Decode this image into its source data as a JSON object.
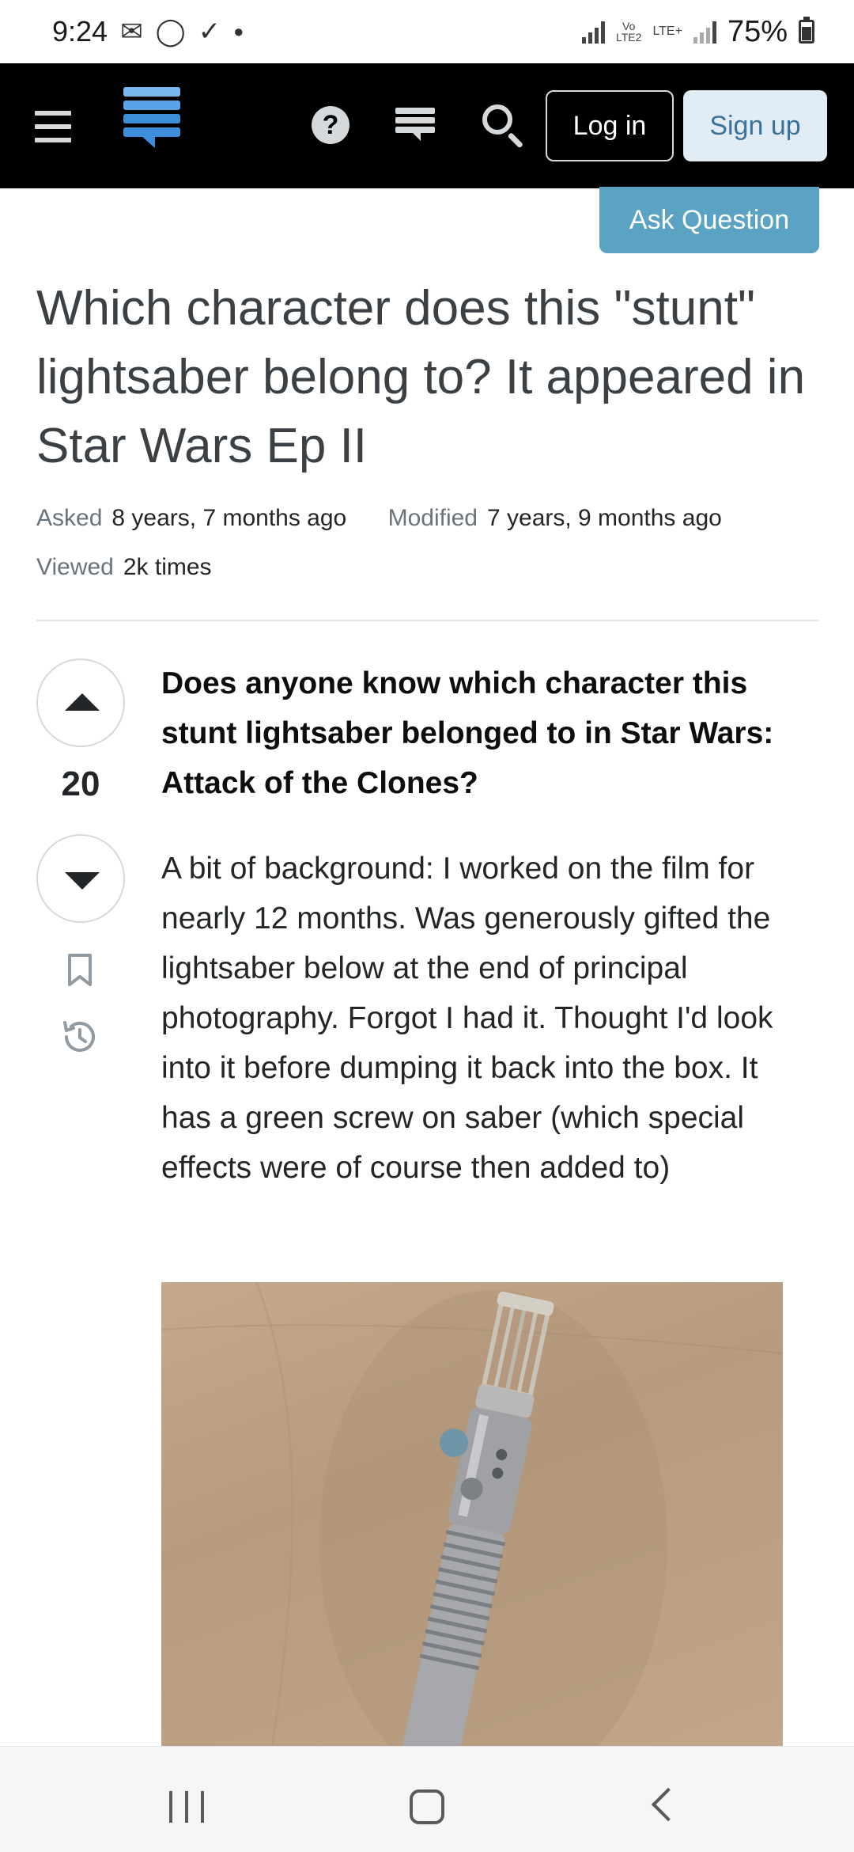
{
  "status_bar": {
    "time": "9:24",
    "icons": [
      "gmail-icon",
      "whatsapp-icon",
      "task-check-icon",
      "dot-icon"
    ],
    "network_label_top": "Vo",
    "network_label_bottom": "LTE2",
    "lte_label": "LTE+",
    "battery_percent": "75%"
  },
  "header": {
    "menu_icon": "hamburger-menu-icon",
    "logo_icon": "stack-exchange-logo-icon",
    "help_icon": "help-icon",
    "inbox_icon": "inbox-icon",
    "search_icon": "search-icon",
    "login_label": "Log in",
    "signup_label": "Sign up"
  },
  "ask_question_label": "Ask Question",
  "question": {
    "title": "Which character does this \"stunt\" lightsaber belong to? It appeared in Star Wars Ep II",
    "asked_label": "Asked",
    "asked_value": "8 years, 7 months ago",
    "modified_label": "Modified",
    "modified_value": "7 years, 9 months ago",
    "viewed_label": "Viewed",
    "viewed_value": "2k times",
    "score": "20",
    "lead": "Does anyone know which character this stunt lightsaber belonged to in Star Wars: Attack of the Clones?",
    "body": "A bit of background: I worked on the film for nearly 12 months. Was generously gifted the lightsaber below at the end of principal photography. Forgot I had it. Thought I'd look into it before dumping it back into the box. It has a green screw on saber (which special effects were of course then added to)"
  },
  "colors": {
    "header_bg": "#000000",
    "ask_button": "#5ba3c2",
    "signup_bg": "#e1ecf4",
    "signup_text": "#39739d",
    "photo_background": "#c2a68a"
  },
  "bottom_nav": {
    "icons": [
      "recent-apps-icon",
      "home-icon",
      "back-icon"
    ]
  }
}
